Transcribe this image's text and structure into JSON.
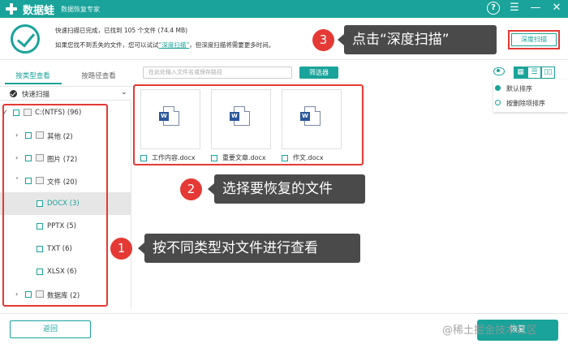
{
  "app": {
    "name": "数据蛙",
    "subtitle": "数据恢复专家"
  },
  "window": {
    "help": "?",
    "menu": "☰",
    "minimize": "—",
    "close": "✕"
  },
  "summary": {
    "line1": "快速扫描已完成，已找到 105 个文件 (74.4 MB)",
    "line2_pre": "如果您找不到丢失的文件，您可以试试",
    "line2_link": "“深度扫描”",
    "line2_post": "，但深度扫描将需要更多时间。",
    "deep_scan_label": "深度扫描"
  },
  "tabs": [
    {
      "label": "按类型查看",
      "active": true
    },
    {
      "label": "按路径查看",
      "active": false
    }
  ],
  "quick_scan_label": "快速扫描",
  "tree": [
    {
      "label": "C:(NTFS) (96)",
      "arrow": "✓"
    },
    {
      "label": "其他 (2)",
      "arrow": "›"
    },
    {
      "label": "图片 (72)",
      "arrow": "›"
    },
    {
      "label": "文件 (20)",
      "arrow": "˅"
    },
    {
      "label": "DOCX (3)"
    },
    {
      "label": "PPTX (5)"
    },
    {
      "label": "TXT (6)"
    },
    {
      "label": "XLSX (6)"
    },
    {
      "label": "数据库 (2)",
      "arrow": "›"
    }
  ],
  "search": {
    "placeholder": "在此处输入文件名或保存路径"
  },
  "filter_label": "筛选器",
  "view_icons": [
    "▦",
    "☰",
    "▯▯"
  ],
  "sort": [
    {
      "label": "默认排序",
      "selected": true
    },
    {
      "label": "按删除项排序",
      "selected": false
    }
  ],
  "files": [
    {
      "name": "工作内容.docx",
      "badge": "W"
    },
    {
      "name": "重要文章.docx",
      "badge": "W"
    },
    {
      "name": "作文.docx",
      "badge": "W"
    }
  ],
  "callouts": [
    {
      "num": "3",
      "text": "点击“深度扫描”"
    },
    {
      "num": "2",
      "text": "选择要恢复的文件"
    },
    {
      "num": "1",
      "text": "按不同类型对文件进行查看"
    }
  ],
  "footer": {
    "back_label": "返回",
    "recover_label": "恢复",
    "watermark": "@稀土掘金技术社区"
  },
  "colors": {
    "accent": "#1aa39a",
    "highlight": "#e53935",
    "callout_bg": "#4a4a4a"
  }
}
